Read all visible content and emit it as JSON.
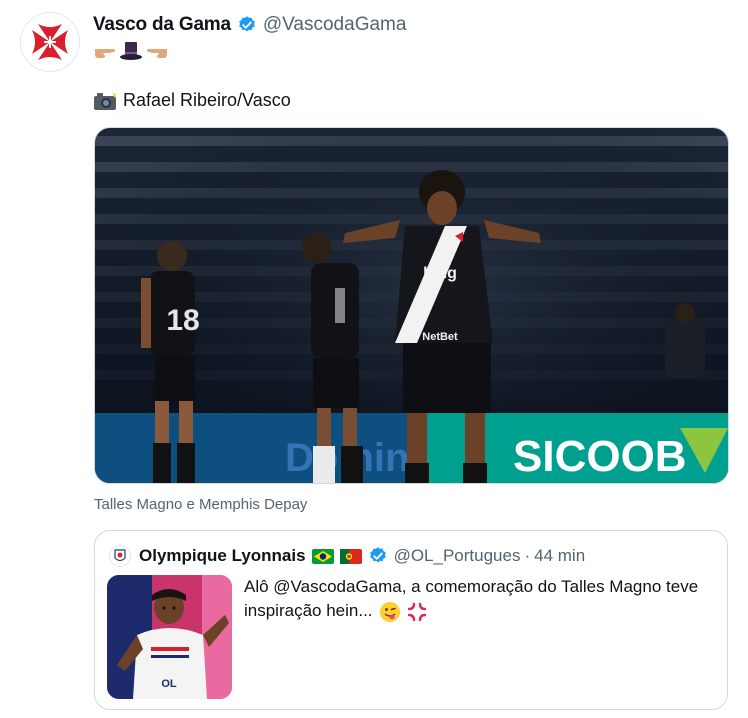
{
  "tweet": {
    "author": {
      "display_name": "Vasco da Gama",
      "handle": "@VascodaGama",
      "verified": true,
      "avatar_icon": "vasco-cross-icon",
      "bio_emojis": [
        "backhand-right-icon",
        "top-hat-icon",
        "backhand-left-icon"
      ]
    },
    "text": "Rafael Ribeiro/Vasco",
    "text_emoji": "camera-flash-icon",
    "media": {
      "description_icon": "player-celebration-photo",
      "jersey_sponsor": "bmg",
      "jersey_sponsor_2": "NetBet",
      "board_text": "SICOOB",
      "board_text_left": "Domin",
      "player_number": "18"
    },
    "media_caption": "Talles Magno e Memphis Depay"
  },
  "quoted_tweet": {
    "display_name": "Olympique Lyonnais",
    "flags": [
      "brazil-flag-icon",
      "portugal-flag-icon"
    ],
    "verified": true,
    "handle": "@OL_Portugues",
    "separator": "·",
    "time": "44 min",
    "text": "Alô @VascodaGama, a comemoração do Talles Magno teve inspiração hein...",
    "emojis": [
      "winking-tongue-face-icon",
      "anger-symbol-icon"
    ],
    "thumb_badge": "OL"
  },
  "colors": {
    "verified_blue": "#1d9bf0",
    "text_primary": "#0f1419",
    "text_secondary": "#536471",
    "border": "#cfd9de",
    "vasco_red": "#d7202b"
  }
}
